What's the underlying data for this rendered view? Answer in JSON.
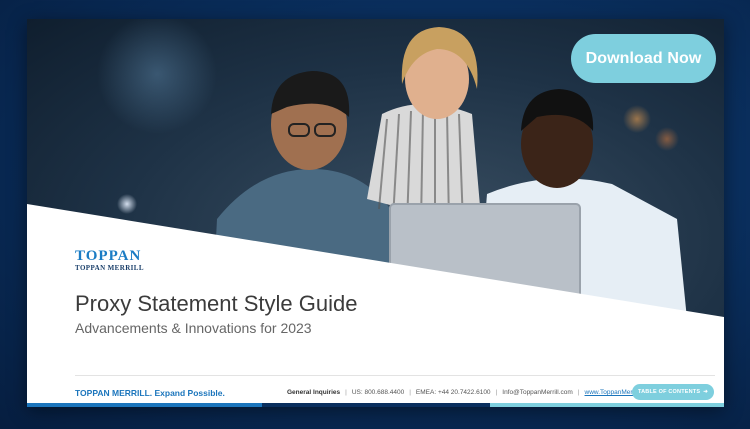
{
  "hero": {
    "download_button": "Download Now"
  },
  "brand": {
    "logo_main": "TOPPAN",
    "logo_sub": "TOPPAN MERRILL"
  },
  "document": {
    "title": "Proxy Statement Style Guide",
    "subtitle": "Advancements & Innovations for 2023"
  },
  "footer": {
    "tagline": "TOPPAN MERRILL. Expand Possible.",
    "general_label": "General Inquiries",
    "us_phone": "US: 800.688.4400",
    "emea_phone": "EMEA: +44 20.7422.6100",
    "email": "Info@ToppanMerrill.com",
    "website": "www.ToppanMerrill.com",
    "toc_button": "TABLE OF CONTENTS"
  },
  "colors": {
    "accent_cyan": "#7ecfde",
    "brand_blue": "#1b75bc",
    "background_navy": "#0a2f5e"
  }
}
